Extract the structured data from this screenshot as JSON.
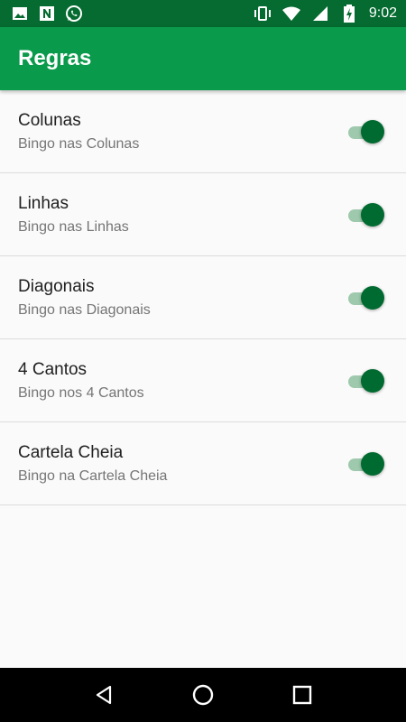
{
  "status_bar": {
    "time": "9:02",
    "left_icons": [
      "image-icon",
      "n-icon",
      "whatsapp-icon"
    ],
    "right_icons": [
      "vibrate-icon",
      "wifi-icon",
      "signal-icon",
      "battery-charging-icon"
    ]
  },
  "app_bar": {
    "title": "Regras",
    "color": "#0a9a4b"
  },
  "rules": [
    {
      "title": "Colunas",
      "subtitle": "Bingo nas Colunas",
      "enabled": true
    },
    {
      "title": "Linhas",
      "subtitle": "Bingo nas Linhas",
      "enabled": true
    },
    {
      "title": "Diagonais",
      "subtitle": "Bingo nas Diagonais",
      "enabled": true
    },
    {
      "title": "4 Cantos",
      "subtitle": "Bingo nos 4 Cantos",
      "enabled": true
    },
    {
      "title": "Cartela Cheia",
      "subtitle": "Bingo na Cartela Cheia",
      "enabled": true
    }
  ],
  "nav_bar": {
    "buttons": [
      "back-icon",
      "home-icon",
      "recents-icon"
    ]
  },
  "colors": {
    "status_bar": "#056b30",
    "accent": "#006b30"
  }
}
